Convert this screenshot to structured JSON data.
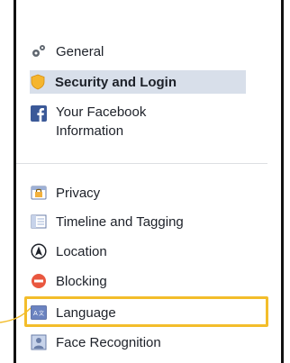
{
  "settings_nav": {
    "group1": [
      {
        "id": "general",
        "label": "General",
        "icon": "gears-icon"
      },
      {
        "id": "security",
        "label": "Security and Login",
        "icon": "shield-icon",
        "selected": true
      },
      {
        "id": "your-facebook-info",
        "label": "Your Facebook Information",
        "icon": "facebook-icon"
      }
    ],
    "group2": [
      {
        "id": "privacy",
        "label": "Privacy",
        "icon": "lock-icon"
      },
      {
        "id": "timeline",
        "label": "Timeline and Tagging",
        "icon": "timeline-icon"
      },
      {
        "id": "location",
        "label": "Location",
        "icon": "location-icon"
      },
      {
        "id": "blocking",
        "label": "Blocking",
        "icon": "block-icon"
      },
      {
        "id": "language",
        "label": "Language",
        "icon": "language-icon",
        "highlighted": true
      },
      {
        "id": "face-recognition",
        "label": "Face Recognition",
        "icon": "face-recognition-icon"
      }
    ]
  },
  "colors": {
    "selected_bg": "#d8dfea",
    "highlight_border": "#f3bd2b",
    "facebook_blue": "#3b5998",
    "blocking_red": "#e9573f"
  }
}
